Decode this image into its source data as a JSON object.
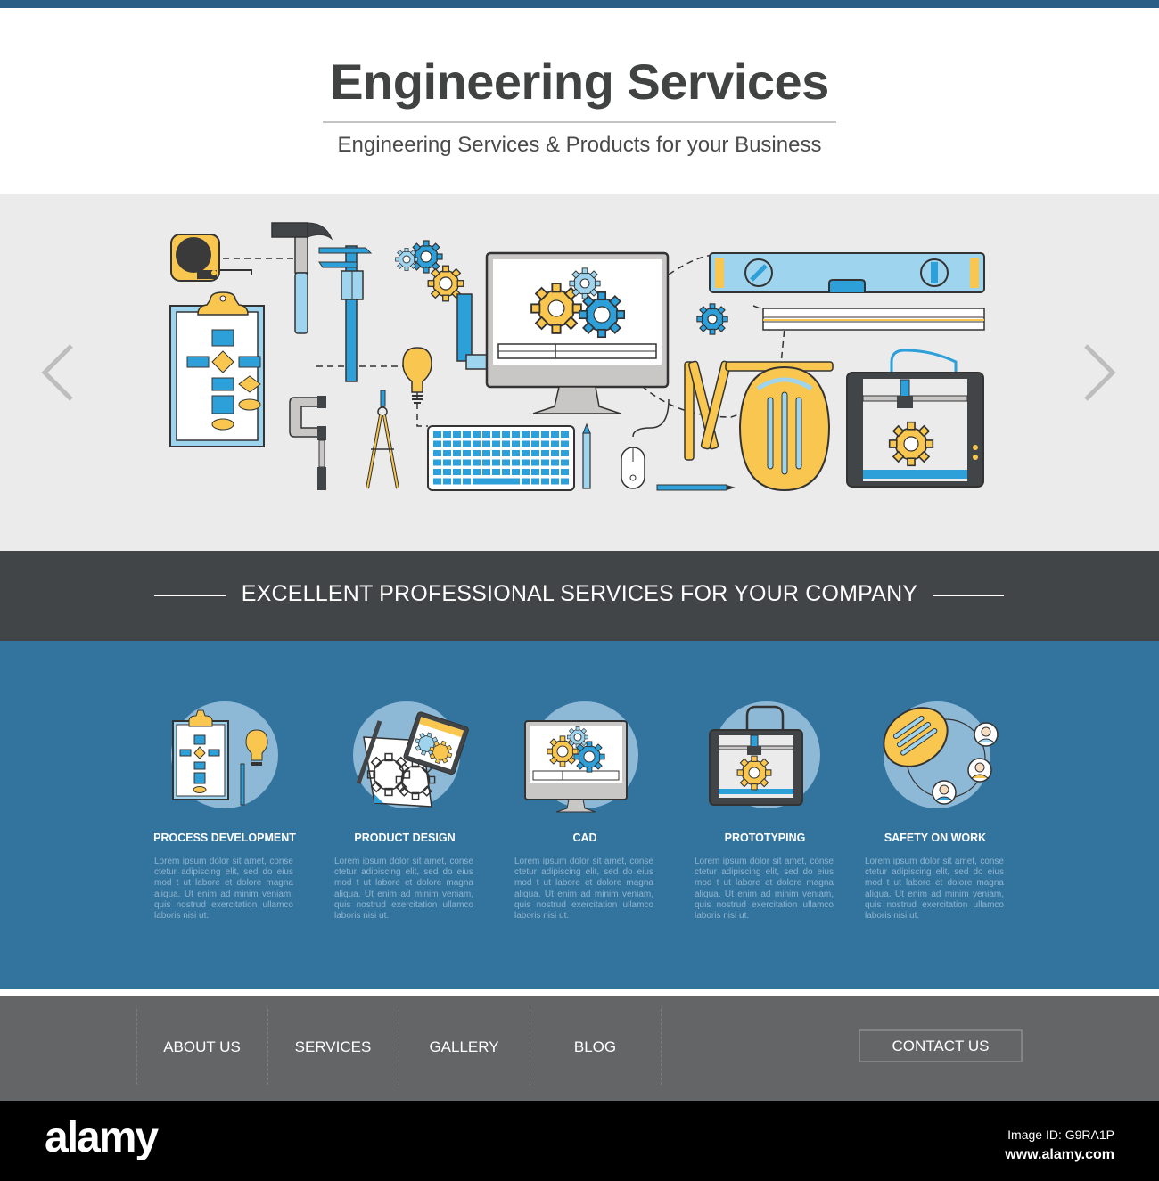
{
  "header": {
    "title": "Engineering Services",
    "subtitle": "Engineering Services & Products for your Business"
  },
  "hero": {
    "prev_label": "previous slide",
    "next_label": "next slide",
    "illustration": [
      "tape-measure",
      "hammer",
      "caliper",
      "gears",
      "computer-monitor",
      "spirit-level",
      "ruler",
      "clipboard-flowchart",
      "c-clamp",
      "compass",
      "light-bulb",
      "square-ruler",
      "keyboard",
      "pencil",
      "mouse",
      "folding-ruler",
      "hard-hat",
      "3d-printer"
    ]
  },
  "band": {
    "text": "EXCELLENT PROFESSIONAL SERVICES FOR YOUR COMPANY"
  },
  "services": [
    {
      "name": "PROCESS DEVELOPMENT",
      "icon": "clipboard-flowchart-icon",
      "desc": "Lorem ipsum dolor sit amet, conse ctetur adipiscing elit, sed do eius mod t ut labore et dolore magna aliqua. Ut enim ad minim veniam, quis nostrud exercitation ullamco laboris nisi ut."
    },
    {
      "name": "PRODUCT DESIGN",
      "icon": "blueprint-tablet-icon",
      "desc": "Lorem ipsum dolor sit amet, conse ctetur adipiscing elit, sed do eius mod t ut labore et dolore magna aliqua. Ut enim ad minim veniam, quis nostrud exercitation ullamco laboris nisi ut."
    },
    {
      "name": "CAD",
      "icon": "computer-gears-icon",
      "desc": "Lorem ipsum dolor sit amet, conse ctetur adipiscing elit, sed do eius mod t ut labore et dolore magna aliqua. Ut enim ad minim veniam, quis nostrud exercitation ullamco laboris nisi ut."
    },
    {
      "name": "PROTOTYPING",
      "icon": "3d-printer-icon",
      "desc": "Lorem ipsum dolor sit amet, conse ctetur adipiscing elit, sed do eius mod t ut labore et dolore magna aliqua. Ut enim ad minim veniam, quis nostrud exercitation ullamco laboris nisi ut."
    },
    {
      "name": "SAFETY ON WORK",
      "icon": "hard-hat-team-icon",
      "desc": "Lorem ipsum dolor sit amet, conse ctetur adipiscing elit, sed do eius mod t ut labore et dolore magna aliqua. Ut enim ad minim veniam, quis nostrud exercitation ullamco laboris nisi ut."
    }
  ],
  "footer": {
    "nav": [
      "ABOUT US",
      "SERVICES",
      "GALLERY",
      "BLOG"
    ],
    "contact": "CONTACT US"
  },
  "watermark": {
    "logo": "alamy",
    "image_id": "Image ID: G9RA1P",
    "url": "www.alamy.com"
  },
  "colors": {
    "top_bar": "#295f86",
    "hero_bg": "#ebebeb",
    "band_bg": "#424547",
    "services_bg": "#33749f",
    "footer_bg": "#636566",
    "accent_yellow": "#f9c74f",
    "accent_blue": "#2d9fd9",
    "accent_light_blue": "#9ed4ee",
    "outline": "#3a3a3a"
  }
}
